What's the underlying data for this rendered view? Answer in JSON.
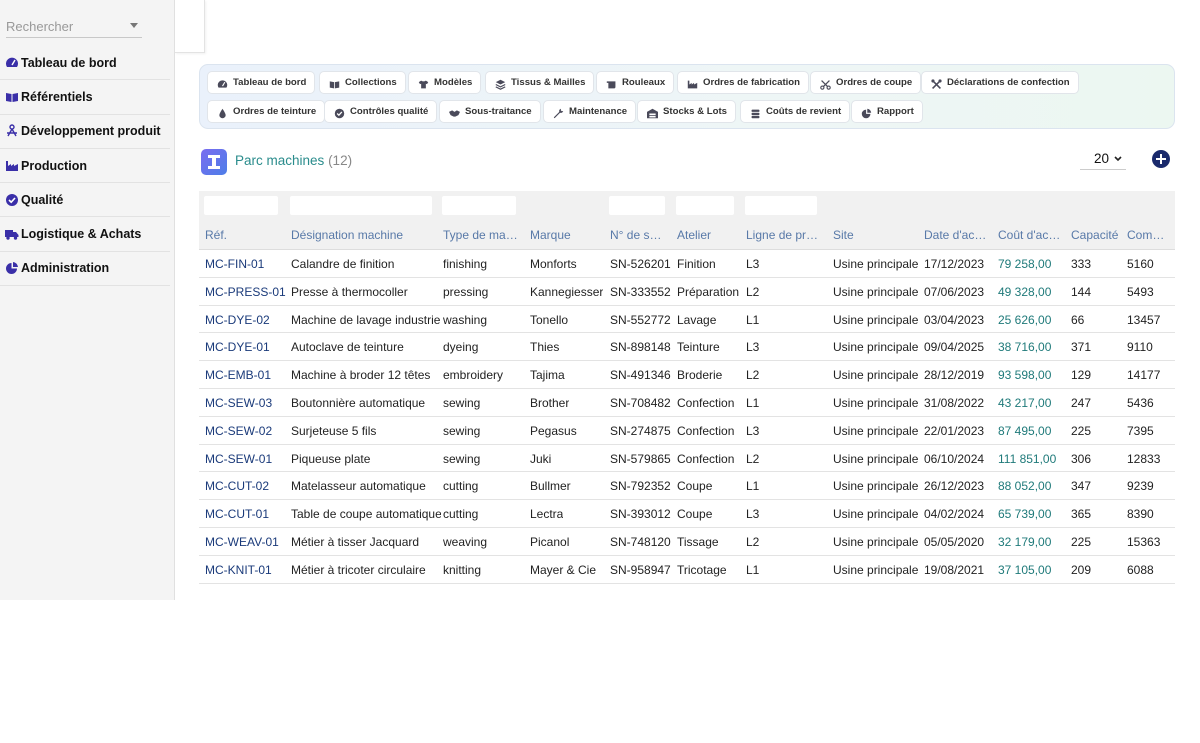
{
  "search": {
    "placeholder": "Rechercher"
  },
  "sidebar": {
    "items": [
      {
        "label": "Tableau de bord",
        "icon": "gauge-icon"
      },
      {
        "label": "Référentiels",
        "icon": "book-icon"
      },
      {
        "label": "Développement produit",
        "icon": "design-icon"
      },
      {
        "label": "Production",
        "icon": "factory-icon"
      },
      {
        "label": "Qualité",
        "icon": "check-circle-icon"
      },
      {
        "label": "Logistique & Achats",
        "icon": "truck-icon"
      },
      {
        "label": "Administration",
        "icon": "pie-chart-icon"
      }
    ]
  },
  "modules": [
    {
      "label": "Tableau de bord",
      "icon": "gauge-icon"
    },
    {
      "label": "Collections",
      "icon": "book-icon"
    },
    {
      "label": "Modèles",
      "icon": "shirt-icon"
    },
    {
      "label": "Tissus & Mailles",
      "icon": "layers-icon"
    },
    {
      "label": "Rouleaux",
      "icon": "scroll-icon"
    },
    {
      "label": "Ordres de fabrication",
      "icon": "factory-icon"
    },
    {
      "label": "Ordres de coupe",
      "icon": "scissors-icon"
    },
    {
      "label": "Déclarations de confection",
      "icon": "tools-icon"
    },
    {
      "label": "Ordres de teinture",
      "icon": "drop-icon"
    },
    {
      "label": "Contrôles qualité",
      "icon": "check-circle-icon"
    },
    {
      "label": "Sous-traitance",
      "icon": "handshake-icon"
    },
    {
      "label": "Maintenance",
      "icon": "wrench-icon"
    },
    {
      "label": "Stocks & Lots",
      "icon": "warehouse-icon"
    },
    {
      "label": "Coûts de revient",
      "icon": "coins-icon"
    },
    {
      "label": "Rapport",
      "icon": "pie-chart-icon"
    }
  ],
  "page": {
    "title": "Parc machines",
    "count": "(12)",
    "page_size": "20"
  },
  "table": {
    "columns": [
      "Réf.",
      "Désignation machine",
      "Type de machine",
      "Marque",
      "N° de série",
      "Atelier",
      "Ligne de production",
      "Site",
      "Date d'achat",
      "Coût d'achat",
      "Capacité",
      "Compteur"
    ],
    "rows": [
      [
        "MC-FIN-01",
        "Calandre de finition",
        "finishing",
        "Monforts",
        "SN-526201",
        "Finition",
        "L3",
        "Usine principale",
        "17/12/2023",
        "79 258,00",
        "333",
        "5160"
      ],
      [
        "MC-PRESS-01",
        "Presse à thermocoller",
        "pressing",
        "Kannegiesser",
        "SN-333552",
        "Préparation",
        "L2",
        "Usine principale",
        "07/06/2023",
        "49 328,00",
        "144",
        "5493"
      ],
      [
        "MC-DYE-02",
        "Machine de lavage industriel",
        "washing",
        "Tonello",
        "SN-552772",
        "Lavage",
        "L1",
        "Usine principale",
        "03/04/2023",
        "25 626,00",
        "66",
        "13457"
      ],
      [
        "MC-DYE-01",
        "Autoclave de teinture",
        "dyeing",
        "Thies",
        "SN-898148",
        "Teinture",
        "L3",
        "Usine principale",
        "09/04/2025",
        "38 716,00",
        "371",
        "9110"
      ],
      [
        "MC-EMB-01",
        "Machine à broder 12 têtes",
        "embroidery",
        "Tajima",
        "SN-491346",
        "Broderie",
        "L2",
        "Usine principale",
        "28/12/2019",
        "93 598,00",
        "129",
        "14177"
      ],
      [
        "MC-SEW-03",
        "Boutonnière automatique",
        "sewing",
        "Brother",
        "SN-708482",
        "Confection",
        "L1",
        "Usine principale",
        "31/08/2022",
        "43 217,00",
        "247",
        "5436"
      ],
      [
        "MC-SEW-02",
        "Surjeteuse 5 fils",
        "sewing",
        "Pegasus",
        "SN-274875",
        "Confection",
        "L3",
        "Usine principale",
        "22/01/2023",
        "87 495,00",
        "225",
        "7395"
      ],
      [
        "MC-SEW-01",
        "Piqueuse plate",
        "sewing",
        "Juki",
        "SN-579865",
        "Confection",
        "L2",
        "Usine principale",
        "06/10/2024",
        "111 851,00",
        "306",
        "12833"
      ],
      [
        "MC-CUT-02",
        "Matelasseur automatique",
        "cutting",
        "Bullmer",
        "SN-792352",
        "Coupe",
        "L1",
        "Usine principale",
        "26/12/2023",
        "88 052,00",
        "347",
        "9239"
      ],
      [
        "MC-CUT-01",
        "Table de coupe automatique",
        "cutting",
        "Lectra",
        "SN-393012",
        "Coupe",
        "L3",
        "Usine principale",
        "04/02/2024",
        "65 739,00",
        "365",
        "8390"
      ],
      [
        "MC-WEAV-01",
        "Métier à tisser Jacquard",
        "weaving",
        "Picanol",
        "SN-748120",
        "Tissage",
        "L2",
        "Usine principale",
        "05/05/2020",
        "32 179,00",
        "225",
        "15363"
      ],
      [
        "MC-KNIT-01",
        "Métier à tricoter circulaire",
        "knitting",
        "Mayer & Cie",
        "SN-958947",
        "Tricotage",
        "L1",
        "Usine principale",
        "19/08/2021",
        "37 105,00",
        "209",
        "6088"
      ]
    ]
  },
  "colors": {
    "accent": "#2a8c8c",
    "link": "#1a3a7a",
    "header_text": "#5879a8",
    "add_button": "#1a2a6c",
    "title_icon": "#6f72ee"
  }
}
